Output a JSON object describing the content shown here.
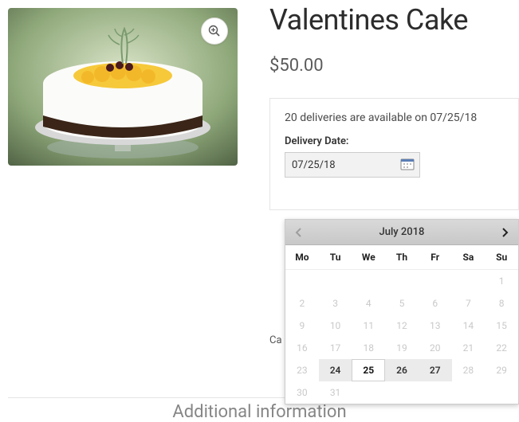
{
  "product": {
    "title": "Valentines Cake",
    "price_display": "$50.00"
  },
  "delivery": {
    "availability_message": "20 deliveries are available on 07/25/18",
    "label": "Delivery Date:",
    "value": "07/25/18"
  },
  "category_label": "Ca",
  "additional_heading": "Additional information",
  "calendar": {
    "month_label": "July 2018",
    "dow": [
      "Mo",
      "Tu",
      "We",
      "Th",
      "Fr",
      "Sa",
      "Su"
    ],
    "days": [
      {
        "n": "",
        "state": ""
      },
      {
        "n": "",
        "state": ""
      },
      {
        "n": "",
        "state": ""
      },
      {
        "n": "",
        "state": ""
      },
      {
        "n": "",
        "state": ""
      },
      {
        "n": "",
        "state": ""
      },
      {
        "n": "1",
        "state": "disabled"
      },
      {
        "n": "2",
        "state": "disabled"
      },
      {
        "n": "3",
        "state": "disabled"
      },
      {
        "n": "4",
        "state": "disabled"
      },
      {
        "n": "5",
        "state": "disabled"
      },
      {
        "n": "6",
        "state": "disabled"
      },
      {
        "n": "7",
        "state": "disabled"
      },
      {
        "n": "8",
        "state": "disabled"
      },
      {
        "n": "9",
        "state": "disabled"
      },
      {
        "n": "10",
        "state": "disabled"
      },
      {
        "n": "11",
        "state": "disabled"
      },
      {
        "n": "12",
        "state": "disabled"
      },
      {
        "n": "13",
        "state": "disabled"
      },
      {
        "n": "14",
        "state": "disabled"
      },
      {
        "n": "15",
        "state": "disabled"
      },
      {
        "n": "16",
        "state": "disabled"
      },
      {
        "n": "17",
        "state": "disabled"
      },
      {
        "n": "18",
        "state": "disabled"
      },
      {
        "n": "19",
        "state": "disabled"
      },
      {
        "n": "20",
        "state": "disabled"
      },
      {
        "n": "21",
        "state": "disabled"
      },
      {
        "n": "22",
        "state": "disabled"
      },
      {
        "n": "23",
        "state": "disabled"
      },
      {
        "n": "24",
        "state": "available"
      },
      {
        "n": "25",
        "state": "selected"
      },
      {
        "n": "26",
        "state": "available"
      },
      {
        "n": "27",
        "state": "available"
      },
      {
        "n": "28",
        "state": "disabled"
      },
      {
        "n": "29",
        "state": "disabled"
      },
      {
        "n": "30",
        "state": "disabled"
      },
      {
        "n": "31",
        "state": "disabled"
      },
      {
        "n": "",
        "state": ""
      },
      {
        "n": "",
        "state": ""
      },
      {
        "n": "",
        "state": ""
      },
      {
        "n": "",
        "state": ""
      },
      {
        "n": "",
        "state": ""
      }
    ]
  }
}
